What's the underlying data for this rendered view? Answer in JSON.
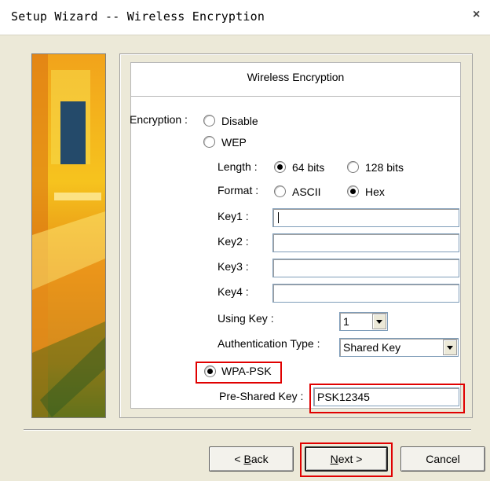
{
  "window": {
    "title": "Setup Wizard -- Wireless Encryption",
    "close_label": "×"
  },
  "banner": {
    "title": "Wireless Encryption"
  },
  "encryption": {
    "label": "Encryption :",
    "options": {
      "disable": "Disable",
      "wep": "WEP",
      "wpa_psk": "WPA-PSK"
    },
    "selected": "wpa_psk"
  },
  "wep": {
    "length_label": "Length :",
    "length_options": [
      "64 bits",
      "128 bits"
    ],
    "length_selected": "64 bits",
    "format_label": "Format :",
    "format_options": [
      "ASCII",
      "Hex"
    ],
    "format_selected": "Hex",
    "keys": [
      {
        "label": "Key1 :",
        "value": ""
      },
      {
        "label": "Key2 :",
        "value": ""
      },
      {
        "label": "Key3 :",
        "value": ""
      },
      {
        "label": "Key4 :",
        "value": ""
      }
    ],
    "using_key_label": "Using Key :",
    "using_key_value": "1",
    "auth_type_label": "Authentication Type :",
    "auth_type_value": "Shared Key"
  },
  "wpa": {
    "psk_label": "Pre-Shared Key :",
    "psk_value": "PSK12345"
  },
  "buttons": {
    "back": {
      "prefix": "< ",
      "mnemonic": "B",
      "rest": "ack"
    },
    "next": {
      "mnemonic": "N",
      "rest": "ext >"
    },
    "cancel": "Cancel"
  },
  "highlight_color": "#e00000"
}
